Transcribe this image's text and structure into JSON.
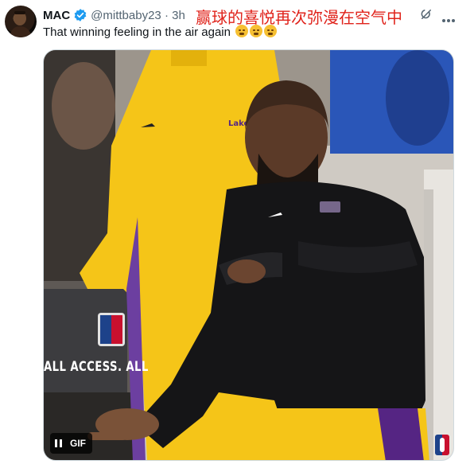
{
  "tweet": {
    "author_name": "MAC",
    "handle_and_time": "@mittbaby23 · 3h",
    "text": "That winning feeling in the air again",
    "emojis": [
      "triumph-face-emoji",
      "triumph-face-emoji",
      "triumph-face-emoji"
    ],
    "verified_badge_icon": "verified-badge-icon",
    "more_icon": "more-icon",
    "grok_icon": "grok-icon"
  },
  "overlay_caption": "赢球的喜悦再次弥漫在空气中",
  "media": {
    "type": "GIF",
    "gif_label": "GIF",
    "pause_icon": "pause-icon",
    "arena_ad_text": "ALL ACCESS. ALL",
    "watermark_icon": "nba-logo-icon"
  },
  "colors": {
    "caption_red": "#e0231b",
    "verified_blue": "#1d9bf0",
    "text_primary": "#0f1419",
    "text_secondary": "#536471",
    "lakers_gold": "#f5c518",
    "lakers_purple": "#552583"
  }
}
